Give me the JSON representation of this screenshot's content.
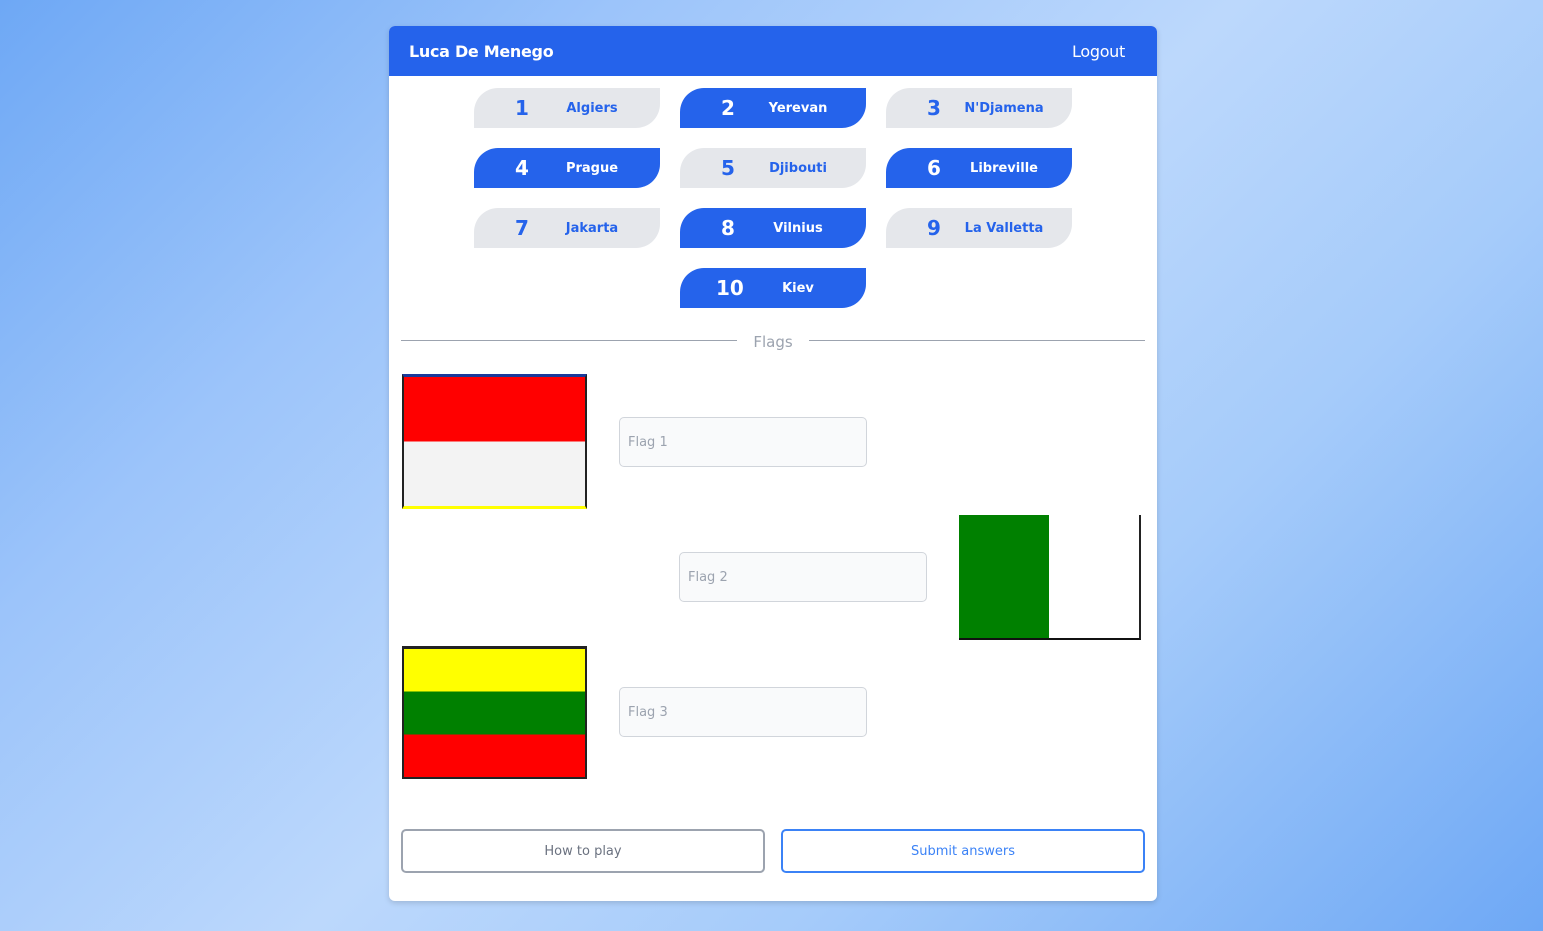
{
  "navbar": {
    "user_name": "Luca De Menego",
    "logout_label": "Logout"
  },
  "capitals": [
    {
      "num": "1",
      "city": "Algiers",
      "selected": false
    },
    {
      "num": "2",
      "city": "Yerevan",
      "selected": true
    },
    {
      "num": "3",
      "city": "N'Djamena",
      "selected": false
    },
    {
      "num": "4",
      "city": "Prague",
      "selected": true
    },
    {
      "num": "5",
      "city": "Djibouti",
      "selected": false
    },
    {
      "num": "6",
      "city": "Libreville",
      "selected": true
    },
    {
      "num": "7",
      "city": "Jakarta",
      "selected": false
    },
    {
      "num": "8",
      "city": "Vilnius",
      "selected": true
    },
    {
      "num": "9",
      "city": "La Valletta",
      "selected": false
    },
    {
      "num": "10",
      "city": "Kiev",
      "selected": true
    }
  ],
  "section_label": "Flags",
  "flags": [
    {
      "name": "flag-1",
      "placeholder": "Flag 1",
      "value": "",
      "colors": [
        "#ff0000",
        "#f3f3f3"
      ],
      "orientation": "horizontal"
    },
    {
      "name": "flag-2",
      "placeholder": "Flag 2",
      "value": "",
      "colors": [
        "#008000",
        "#ffffff"
      ],
      "orientation": "vertical"
    },
    {
      "name": "flag-3",
      "placeholder": "Flag 3",
      "value": "",
      "colors": [
        "#ffff00",
        "#008000",
        "#ff0000"
      ],
      "orientation": "horizontal"
    }
  ],
  "buttons": {
    "how_to_play": "How to play",
    "submit": "Submit answers"
  },
  "colors": {
    "primary": "#2563eb",
    "pill_inactive": "#e5e7eb"
  }
}
